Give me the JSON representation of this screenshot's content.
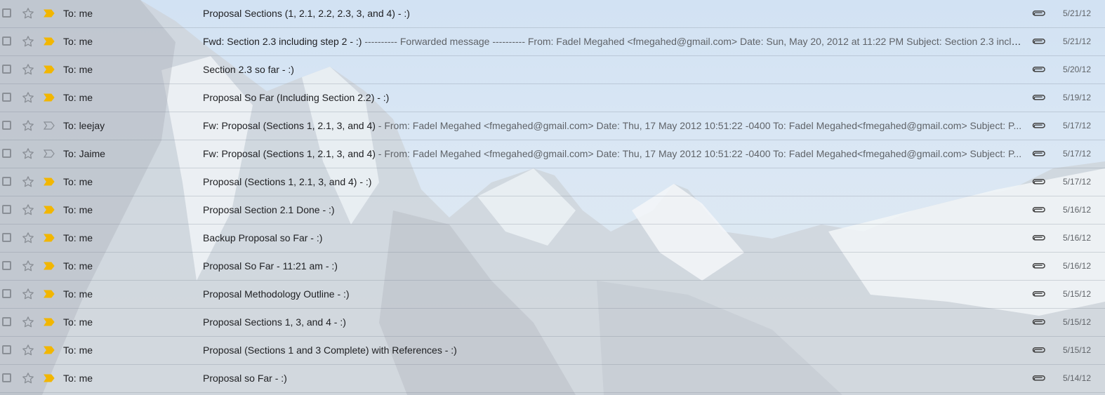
{
  "emails": [
    {
      "to": "To: me",
      "subject": "Proposal Sections (1, 2.1, 2.2, 2.3, 3, and 4) - :)",
      "snippet": "",
      "date": "5/21/12",
      "important": true
    },
    {
      "to": "To: me",
      "subject": "Fwd: Section 2.3 including step 2 - :)",
      "snippet": " ---------- Forwarded message ---------- From: Fadel Megahed <fmegahed@gmail.com> Date: Sun, May 20, 2012 at 11:22 PM Subject: Section 2.3 inclu...",
      "date": "5/21/12",
      "important": true
    },
    {
      "to": "To: me",
      "subject": "Section 2.3 so far - :)",
      "snippet": "",
      "date": "5/20/12",
      "important": true
    },
    {
      "to": "To: me",
      "subject": "Proposal So Far (Including Section 2.2) - :)",
      "snippet": "",
      "date": "5/19/12",
      "important": true
    },
    {
      "to": "To: leejay",
      "subject": "Fw: Proposal (Sections 1, 2.1, 3, and 4)",
      "snippet": " - From: Fadel Megahed <fmegahed@gmail.com> Date: Thu, 17 May 2012 10:51:22 -0400 To: Fadel Megahed<fmegahed@gmail.com> Subject: P...",
      "date": "5/17/12",
      "important": false
    },
    {
      "to": "To: Jaime",
      "subject": "Fw: Proposal (Sections 1, 2.1, 3, and 4)",
      "snippet": " - From: Fadel Megahed <fmegahed@gmail.com> Date: Thu, 17 May 2012 10:51:22 -0400 To: Fadel Megahed<fmegahed@gmail.com> Subject: P...",
      "date": "5/17/12",
      "important": false
    },
    {
      "to": "To: me",
      "subject": "Proposal (Sections 1, 2.1, 3, and 4) - :)",
      "snippet": "",
      "date": "5/17/12",
      "important": true
    },
    {
      "to": "To: me",
      "subject": "Proposal Section 2.1 Done - :)",
      "snippet": "",
      "date": "5/16/12",
      "important": true
    },
    {
      "to": "To: me",
      "subject": "Backup Proposal so Far - :)",
      "snippet": "",
      "date": "5/16/12",
      "important": true
    },
    {
      "to": "To: me",
      "subject": "Proposal So Far - 11:21 am - :)",
      "snippet": "",
      "date": "5/16/12",
      "important": true
    },
    {
      "to": "To: me",
      "subject": "Proposal Methodology Outline - :)",
      "snippet": "",
      "date": "5/15/12",
      "important": true
    },
    {
      "to": "To: me",
      "subject": "Proposal Sections 1, 3, and 4 - :)",
      "snippet": "",
      "date": "5/15/12",
      "important": true
    },
    {
      "to": "To: me",
      "subject": "Proposal (Sections 1 and 3 Complete) with References - :)",
      "snippet": "",
      "date": "5/15/12",
      "important": true
    },
    {
      "to": "To: me",
      "subject": "Proposal so Far - :)",
      "snippet": "",
      "date": "5/14/12",
      "important": true
    }
  ],
  "colors": {
    "important_marker": "#f2b600",
    "muted_text": "#5f6368"
  },
  "icons": {
    "checkbox": "checkbox-icon",
    "star": "star-icon",
    "important": "important-marker-icon",
    "attachment": "attachment-icon"
  }
}
